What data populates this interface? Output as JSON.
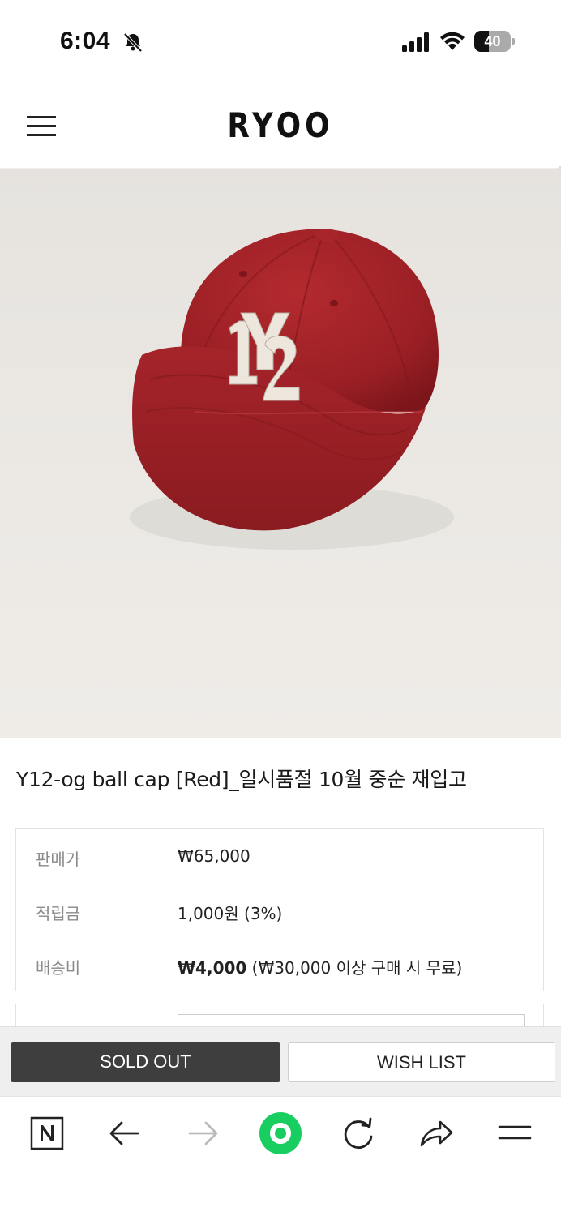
{
  "status_bar": {
    "time": "6:04",
    "battery_level": "40",
    "battery_fraction": 0.4,
    "icons": [
      "bell-slash-icon",
      "signal-icon",
      "wifi-icon",
      "battery-icon"
    ]
  },
  "header": {
    "logo": "RYOO",
    "menu_icon": "hamburger-menu-icon"
  },
  "product": {
    "image_alt": "red ball cap with Y12 patch",
    "title": "Y12-og ball cap [Red]_일시품절 10월 중순 재입고",
    "colors": {
      "cap": "#9e1f24",
      "patch": "#ece6dc"
    }
  },
  "info": {
    "rows": [
      {
        "label": "판매가",
        "value": "₩65,000"
      },
      {
        "label": "적립금",
        "value": "1,000원 (3%)"
      },
      {
        "label": "배송비",
        "value_bold": "₩4,000",
        "value_rest": " (₩30,000 이상 구매 시 무료)"
      }
    ]
  },
  "actions": {
    "sold_out": "SOLD OUT",
    "wish_list": "WISH LIST",
    "colors": {
      "sold_out_bg": "#3e3e3e",
      "wish_bg": "#ffffff"
    }
  },
  "toolbar": {
    "items": [
      "naver-n-icon",
      "back-arrow-icon",
      "forward-arrow-icon",
      "home-circle-icon",
      "reload-icon",
      "share-icon",
      "menu-icon"
    ],
    "accent": "#19ce60"
  }
}
